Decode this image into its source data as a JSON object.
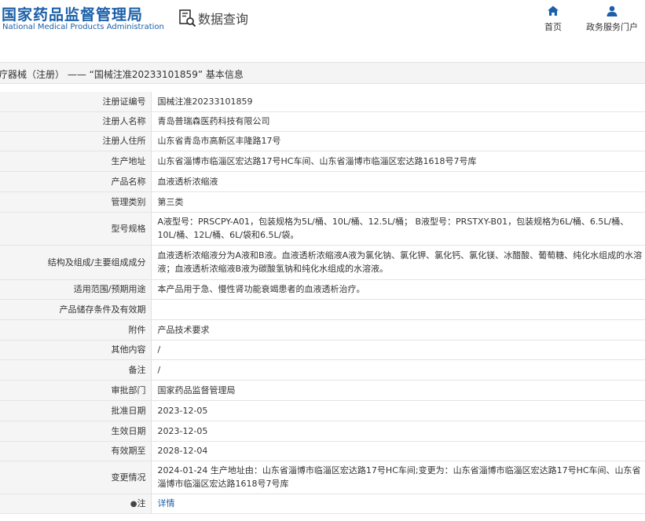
{
  "header": {
    "logo_cn": "国家药品监督管理局",
    "logo_en": "National Medical Products Administration",
    "query_label": "数据查询",
    "nav": [
      {
        "label": "首页",
        "icon": "home-icon"
      },
      {
        "label": "政务服务门户",
        "icon": "user-icon"
      }
    ]
  },
  "title": "疗器械（注册） —— “国械注准20233101859” 基本信息",
  "colors": {
    "brand": "#1b5fa8",
    "label_bg": "#f5f5f5",
    "border": "#e4e4e4"
  },
  "rows": [
    {
      "label": "注册证编号",
      "value": "国械注准20233101859"
    },
    {
      "label": "注册人名称",
      "value": "青岛普瑞森医药科技有限公司"
    },
    {
      "label": "注册人住所",
      "value": "山东省青岛市高新区丰隆路17号"
    },
    {
      "label": "生产地址",
      "value": "山东省淄博市临淄区宏达路17号HC车间、山东省淄博市临淄区宏达路1618号7号库"
    },
    {
      "label": "产品名称",
      "value": "血液透析浓缩液"
    },
    {
      "label": "管理类别",
      "value": "第三类"
    },
    {
      "label": "型号规格",
      "value": "A液型号：PRSCPY-A01，包装规格为5L/桶、10L/桶、12.5L/桶； B液型号：PRSTXY-B01，包装规格为6L/桶、6.5L/桶、10L/桶、12L/桶、6L/袋和6.5L/袋。"
    },
    {
      "label": "结构及组成/主要组成成分",
      "value": "血液透析浓缩液分为A液和B液。血液透析浓缩液A液为氯化钠、氯化钾、氯化钙、氯化镁、冰醋酸、葡萄糖、纯化水组成的水溶液；血液透析浓缩液B液为碳酸氢钠和纯化水组成的水溶液。"
    },
    {
      "label": "适用范围/预期用途",
      "value": "本产品用于急、慢性肾功能衰竭患者的血液透析治疗。"
    },
    {
      "label": "产品储存条件及有效期",
      "value": ""
    },
    {
      "label": "附件",
      "value": "产品技术要求"
    },
    {
      "label": "其他内容",
      "value": "/"
    },
    {
      "label": "备注",
      "value": "/"
    },
    {
      "label": "审批部门",
      "value": "国家药品监督管理局"
    },
    {
      "label": "批准日期",
      "value": "2023-12-05"
    },
    {
      "label": "生效日期",
      "value": "2023-12-05"
    },
    {
      "label": "有效期至",
      "value": "2028-12-04"
    },
    {
      "label": "变更情况",
      "value": "2024-01-24 生产地址由：山东省淄博市临淄区宏达路17号HC车间;变更为：山东省淄博市临淄区宏达路17号HC车间、山东省淄博市临淄区宏达路1618号7号库"
    }
  ],
  "note": {
    "label": "注",
    "icon": "pin-icon",
    "link": "详情"
  }
}
